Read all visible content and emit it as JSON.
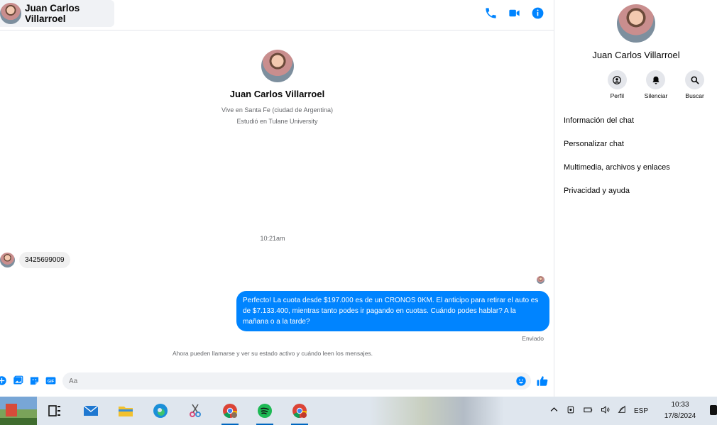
{
  "header": {
    "contact_name": "Juan Carlos Villarroel",
    "icons": [
      "phone-icon",
      "video-icon",
      "info-icon"
    ],
    "accent_color": "#0084ff"
  },
  "profile": {
    "name": "Juan Carlos Villarroel",
    "lives": "Vive en Santa Fe (ciudad de Argentina)",
    "studied": "Estudió en Tulane University"
  },
  "conversation": {
    "timestamp": "10:21am",
    "incoming_message": "3425699009",
    "outgoing_message": "Perfecto! La cuota desde $197.000 es de un CRONOS 0KM. El anticipo para retirar el auto es de $7.133.400, mientras tanto podes ir pagando en cuotas. Cuándo podes hablar? A la mañana o a la tarde?",
    "sent_status": "Enviado",
    "info_notice": "Ahora pueden llamarse y ver su estado activo y cuándo leen los mensajes."
  },
  "composer": {
    "placeholder": "Aa",
    "value": "",
    "tools": [
      "plus-icon",
      "image-icon",
      "sticker-icon",
      "gif-icon"
    ],
    "gif_label": "GIF"
  },
  "sidebar": {
    "name": "Juan Carlos Villarroel",
    "actions": [
      {
        "label": "Perfil",
        "icon": "profile-icon"
      },
      {
        "label": "Silenciar",
        "icon": "bell-icon"
      },
      {
        "label": "Buscar",
        "icon": "search-icon"
      }
    ],
    "menu": [
      "Información del chat",
      "Personalizar chat",
      "Multimedia, archivos y enlaces",
      "Privacidad y ayuda"
    ]
  },
  "taskbar": {
    "apps": [
      "task-view-icon",
      "mail-icon",
      "file-explorer-icon",
      "edge-icon",
      "snipping-tool-icon",
      "chrome-icon",
      "spotify-icon",
      "chrome-icon"
    ],
    "language": "ESP",
    "time": "10:33",
    "date": "17/8/2024"
  }
}
